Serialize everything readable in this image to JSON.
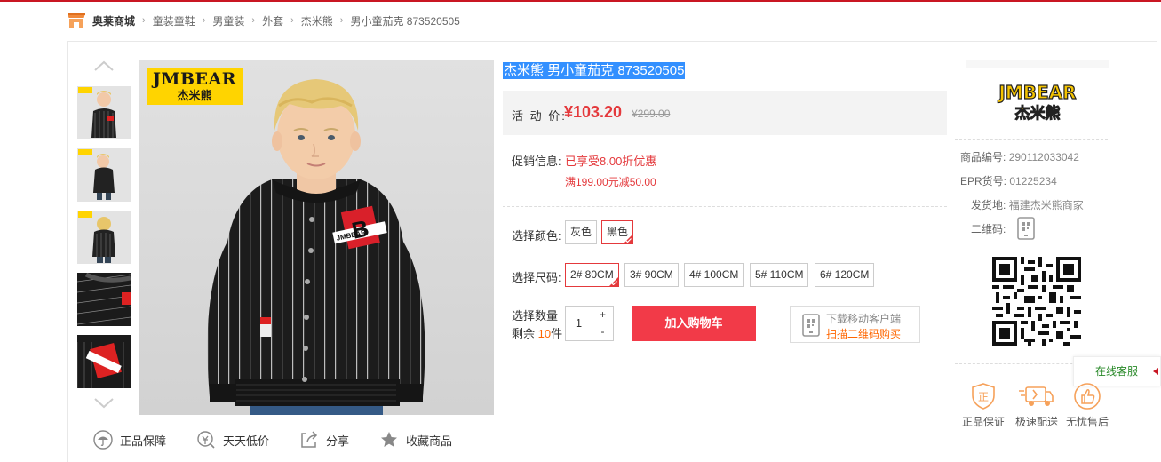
{
  "breadcrumb": {
    "home": "奥莱商城",
    "items": [
      "童装童鞋",
      "男童装",
      "外套",
      "杰米熊",
      "男小童茄克 873520505"
    ]
  },
  "gallery": {
    "brand_en": "JMBEAR",
    "brand_cn": "杰米熊",
    "patch_letter": "B",
    "patch_text": "JMBEAR"
  },
  "actions": [
    "正品保障",
    "天天低价",
    "分享",
    "收藏商品"
  ],
  "product": {
    "title": "杰米熊 男小童茄克 873520505",
    "price_label": "活 动 价:",
    "price": "¥103.20",
    "original_price": "¥299.00",
    "promo_label": "促销信息:",
    "promo_1": "已享受8.00折优惠",
    "promo_2": "满199.00元减50.00",
    "color_label": "选择颜色:",
    "colors": [
      "灰色",
      "黑色"
    ],
    "selected_color": "黑色",
    "size_label": "选择尺码:",
    "sizes": [
      "2# 80CM",
      "3# 90CM",
      "4# 100CM",
      "5# 110CM",
      "6# 120CM"
    ],
    "selected_size": "2# 80CM",
    "qty_label": "选择数量",
    "stock_prefix": "剩余",
    "stock": "10",
    "stock_suffix": "件",
    "qty": "1",
    "plus": "+",
    "minus": "-",
    "add_to_cart": "加入购物车",
    "mobile_line1": "下载移动客户端",
    "mobile_line2": "扫描二维码购买"
  },
  "shop": {
    "logo_en": "JMBEAR",
    "logo_cn": "杰米熊",
    "product_no_label": "商品编号:",
    "product_no": "290112033042",
    "epr_label": "EPR货号:",
    "epr": "01225234",
    "ship_label": "发货地:",
    "ship": "福建杰米熊商家",
    "qr_label": "二维码:"
  },
  "customer_service": "在线客服",
  "services": [
    "正品保证",
    "极速配送",
    "无忧售后"
  ],
  "colors": {
    "accent": "#e4393c",
    "cart": "#f23a48",
    "orange": "#ff6600",
    "highlight": "#3390ff"
  }
}
